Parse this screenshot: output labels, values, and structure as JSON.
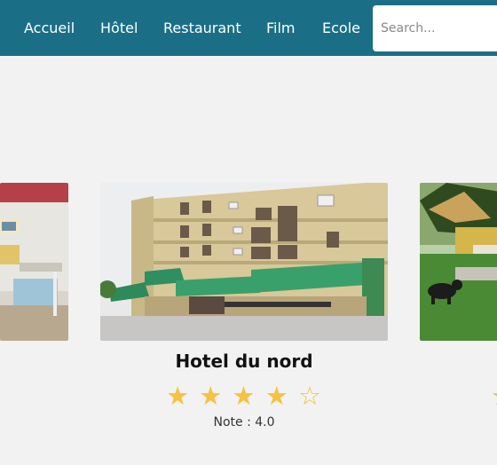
{
  "nav": {
    "links": [
      "Accueil",
      "Hôtel",
      "Restaurant",
      "Film",
      "Ecole"
    ],
    "search_placeholder": "Search..."
  },
  "colors": {
    "navbar": "#1a6f86",
    "background": "#f2f2f2",
    "star": "#f5c242"
  },
  "carousel": {
    "current": {
      "name": "Hotel du nord",
      "stars_filled": 4,
      "stars_total": 5,
      "star_full_glyph": "★",
      "star_empty_glyph": "☆",
      "rating_label": "Note : 4.0"
    }
  }
}
